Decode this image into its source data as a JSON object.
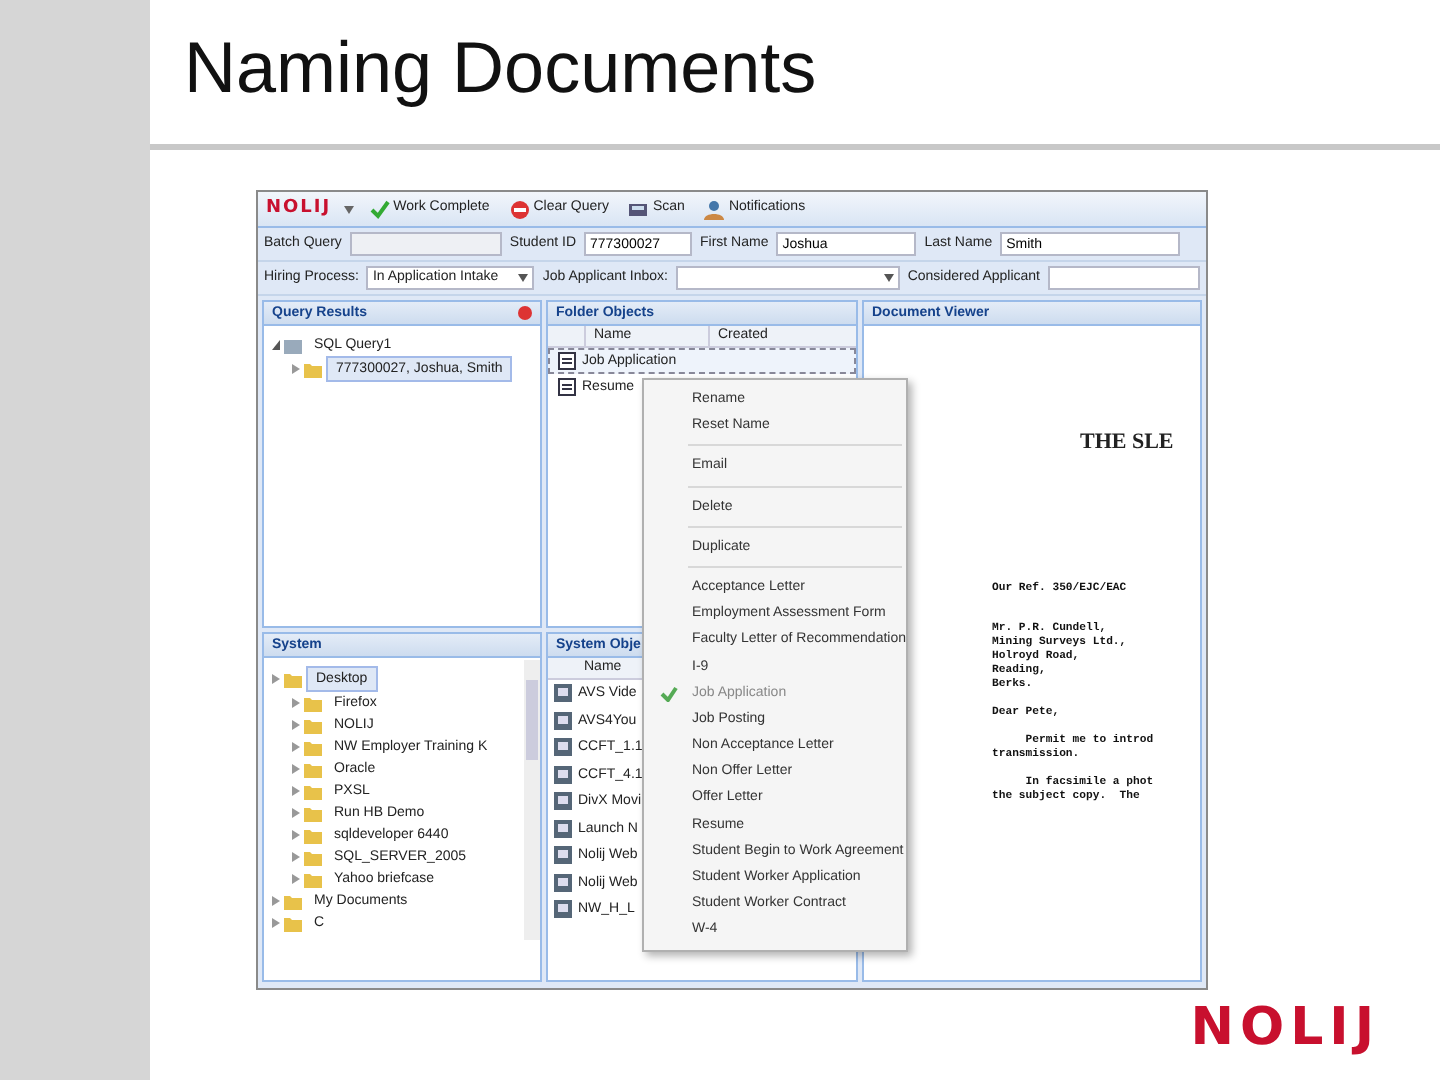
{
  "slide": {
    "title": "Naming Documents",
    "logo": "NOLIJ"
  },
  "app": {
    "toolbar": {
      "logo": "NOLIJ",
      "buttons": [
        {
          "label": "Work Complete",
          "kind": "check"
        },
        {
          "label": "Clear Query",
          "kind": "stop"
        },
        {
          "label": "Scan",
          "kind": "scan"
        },
        {
          "label": "Notifications",
          "kind": "person"
        }
      ]
    },
    "fields": [
      {
        "label": "Batch Query"
      },
      {
        "label": "Student ID",
        "value": "777300027"
      },
      {
        "label": "First Name",
        "value": "Joshua"
      },
      {
        "label": "Last Name",
        "value": "Smith"
      }
    ],
    "filters": [
      {
        "label": "Hiring Process:",
        "value": "In Application Intake",
        "kind": "select"
      },
      {
        "label": "Job Applicant Inbox:",
        "kind": "select"
      },
      {
        "label": "Considered Applicant",
        "kind": "text"
      }
    ],
    "query_results": {
      "title": "Query Results",
      "tree": [
        {
          "label": "SQL Query1",
          "selected": false,
          "children": [
            {
              "label": "777300027, Joshua, Smith",
              "selected": true
            }
          ]
        }
      ]
    },
    "folder_objects": {
      "title": "Folder Objects",
      "columns": [
        "Name",
        "Created"
      ],
      "rows": [
        {
          "name": "Job Application",
          "selected": true
        },
        {
          "name": "Resume",
          "selected": false
        }
      ]
    },
    "system": {
      "title": "System",
      "tree": [
        {
          "label": "Desktop",
          "selected": true,
          "children": [
            {
              "label": "Firefox",
              "selected": false
            },
            {
              "label": "NOLIJ",
              "selected": false
            },
            {
              "label": "NW Employer Training K",
              "selected": false
            },
            {
              "label": "Oracle",
              "selected": false
            },
            {
              "label": "PXSL",
              "selected": false
            },
            {
              "label": "Run HB Demo",
              "selected": false
            },
            {
              "label": "sqldeveloper 6440",
              "selected": false
            },
            {
              "label": "SQL_SERVER_2005",
              "selected": false
            },
            {
              "label": "Yahoo briefcase",
              "selected": false
            }
          ]
        },
        {
          "label": "My Documents",
          "selected": false
        },
        {
          "label": "C",
          "selected": false
        }
      ]
    },
    "system_objects": {
      "title": "System Obje",
      "columns": [
        "Name"
      ],
      "rows": [
        "AVS Vide",
        "AVS4You",
        "CCFT_1.1",
        "CCFT_4.1",
        "DivX Movi",
        "Launch N",
        "Nolij Web",
        "Nolij Web",
        "NW_H_L"
      ]
    },
    "document_viewer": {
      "title": "Document Viewer",
      "letter": {
        "heading": "THE SLE",
        "blocks": [
          [
            "Our Ref. 350/EJC/EAC"
          ],
          [
            "Mr. P.R. Cundell,",
            "Mining Surveys Ltd.,",
            "Holroyd Road,",
            "Reading,",
            "Berks."
          ],
          [
            "Dear Pete,"
          ],
          [
            "     Permit me to introd",
            "transmission."
          ],
          [
            "     In facsimile a phot",
            "the subject copy.  The"
          ]
        ]
      }
    },
    "context_menu": [
      {
        "kind": "item",
        "label": "Rename",
        "checked": false
      },
      {
        "kind": "item",
        "label": "Reset Name",
        "checked": false
      },
      {
        "kind": "separator"
      },
      {
        "kind": "item",
        "label": "Email",
        "checked": false
      },
      {
        "kind": "separator"
      },
      {
        "kind": "item",
        "label": "Delete",
        "checked": false
      },
      {
        "kind": "separator"
      },
      {
        "kind": "item",
        "label": "Duplicate",
        "checked": false
      },
      {
        "kind": "separator"
      },
      {
        "kind": "item",
        "label": "Acceptance Letter",
        "checked": false
      },
      {
        "kind": "item",
        "label": "Employment Assessment Form",
        "checked": false
      },
      {
        "kind": "item",
        "label": "Faculty Letter of Recommendation",
        "checked": false
      },
      {
        "kind": "item",
        "label": "I-9",
        "checked": false
      },
      {
        "kind": "item",
        "label": "Job Application",
        "checked": true
      },
      {
        "kind": "item",
        "label": "Job Posting",
        "checked": false
      },
      {
        "kind": "item",
        "label": "Non Acceptance Letter",
        "checked": false
      },
      {
        "kind": "item",
        "label": "Non Offer Letter",
        "checked": false
      },
      {
        "kind": "item",
        "label": "Offer Letter",
        "checked": false
      },
      {
        "kind": "item",
        "label": "Resume",
        "checked": false
      },
      {
        "kind": "item",
        "label": "Student Begin to Work Agreement",
        "checked": false
      },
      {
        "kind": "item",
        "label": "Student Worker Application",
        "checked": false
      },
      {
        "kind": "item",
        "label": "Student Worker Contract",
        "checked": false
      },
      {
        "kind": "item",
        "label": "W-4",
        "checked": false
      }
    ]
  }
}
